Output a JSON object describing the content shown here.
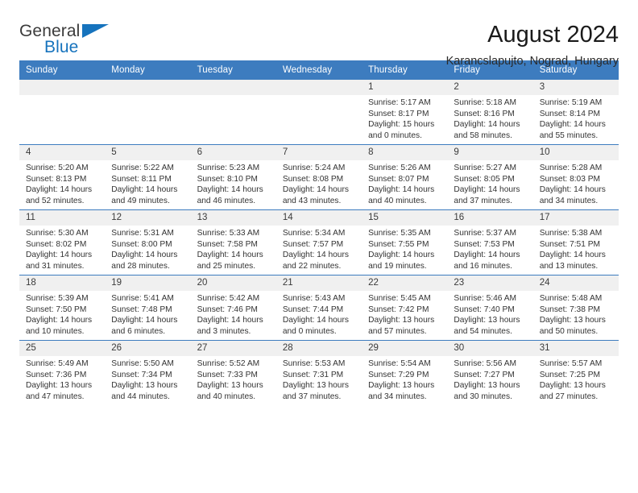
{
  "brand": {
    "word_one": "General",
    "word_two": "Blue",
    "accent_color": "#1673bd",
    "triangle_icon": "triangle-icon"
  },
  "header": {
    "title": "August 2024",
    "subtitle": "Karancslapujto, Nograd, Hungary"
  },
  "calendar": {
    "header_color": "#3d7cbf",
    "weekday_headers": [
      "Sunday",
      "Monday",
      "Tuesday",
      "Wednesday",
      "Thursday",
      "Friday",
      "Saturday"
    ],
    "weeks": [
      [
        {
          "day": "",
          "blank": true
        },
        {
          "day": "",
          "blank": true
        },
        {
          "day": "",
          "blank": true
        },
        {
          "day": "",
          "blank": true
        },
        {
          "day": "1",
          "sunrise": "Sunrise: 5:17 AM",
          "sunset": "Sunset: 8:17 PM",
          "daylight": "Daylight: 15 hours and 0 minutes."
        },
        {
          "day": "2",
          "sunrise": "Sunrise: 5:18 AM",
          "sunset": "Sunset: 8:16 PM",
          "daylight": "Daylight: 14 hours and 58 minutes."
        },
        {
          "day": "3",
          "sunrise": "Sunrise: 5:19 AM",
          "sunset": "Sunset: 8:14 PM",
          "daylight": "Daylight: 14 hours and 55 minutes."
        }
      ],
      [
        {
          "day": "4",
          "sunrise": "Sunrise: 5:20 AM",
          "sunset": "Sunset: 8:13 PM",
          "daylight": "Daylight: 14 hours and 52 minutes."
        },
        {
          "day": "5",
          "sunrise": "Sunrise: 5:22 AM",
          "sunset": "Sunset: 8:11 PM",
          "daylight": "Daylight: 14 hours and 49 minutes."
        },
        {
          "day": "6",
          "sunrise": "Sunrise: 5:23 AM",
          "sunset": "Sunset: 8:10 PM",
          "daylight": "Daylight: 14 hours and 46 minutes."
        },
        {
          "day": "7",
          "sunrise": "Sunrise: 5:24 AM",
          "sunset": "Sunset: 8:08 PM",
          "daylight": "Daylight: 14 hours and 43 minutes."
        },
        {
          "day": "8",
          "sunrise": "Sunrise: 5:26 AM",
          "sunset": "Sunset: 8:07 PM",
          "daylight": "Daylight: 14 hours and 40 minutes."
        },
        {
          "day": "9",
          "sunrise": "Sunrise: 5:27 AM",
          "sunset": "Sunset: 8:05 PM",
          "daylight": "Daylight: 14 hours and 37 minutes."
        },
        {
          "day": "10",
          "sunrise": "Sunrise: 5:28 AM",
          "sunset": "Sunset: 8:03 PM",
          "daylight": "Daylight: 14 hours and 34 minutes."
        }
      ],
      [
        {
          "day": "11",
          "sunrise": "Sunrise: 5:30 AM",
          "sunset": "Sunset: 8:02 PM",
          "daylight": "Daylight: 14 hours and 31 minutes."
        },
        {
          "day": "12",
          "sunrise": "Sunrise: 5:31 AM",
          "sunset": "Sunset: 8:00 PM",
          "daylight": "Daylight: 14 hours and 28 minutes."
        },
        {
          "day": "13",
          "sunrise": "Sunrise: 5:33 AM",
          "sunset": "Sunset: 7:58 PM",
          "daylight": "Daylight: 14 hours and 25 minutes."
        },
        {
          "day": "14",
          "sunrise": "Sunrise: 5:34 AM",
          "sunset": "Sunset: 7:57 PM",
          "daylight": "Daylight: 14 hours and 22 minutes."
        },
        {
          "day": "15",
          "sunrise": "Sunrise: 5:35 AM",
          "sunset": "Sunset: 7:55 PM",
          "daylight": "Daylight: 14 hours and 19 minutes."
        },
        {
          "day": "16",
          "sunrise": "Sunrise: 5:37 AM",
          "sunset": "Sunset: 7:53 PM",
          "daylight": "Daylight: 14 hours and 16 minutes."
        },
        {
          "day": "17",
          "sunrise": "Sunrise: 5:38 AM",
          "sunset": "Sunset: 7:51 PM",
          "daylight": "Daylight: 14 hours and 13 minutes."
        }
      ],
      [
        {
          "day": "18",
          "sunrise": "Sunrise: 5:39 AM",
          "sunset": "Sunset: 7:50 PM",
          "daylight": "Daylight: 14 hours and 10 minutes."
        },
        {
          "day": "19",
          "sunrise": "Sunrise: 5:41 AM",
          "sunset": "Sunset: 7:48 PM",
          "daylight": "Daylight: 14 hours and 6 minutes."
        },
        {
          "day": "20",
          "sunrise": "Sunrise: 5:42 AM",
          "sunset": "Sunset: 7:46 PM",
          "daylight": "Daylight: 14 hours and 3 minutes."
        },
        {
          "day": "21",
          "sunrise": "Sunrise: 5:43 AM",
          "sunset": "Sunset: 7:44 PM",
          "daylight": "Daylight: 14 hours and 0 minutes."
        },
        {
          "day": "22",
          "sunrise": "Sunrise: 5:45 AM",
          "sunset": "Sunset: 7:42 PM",
          "daylight": "Daylight: 13 hours and 57 minutes."
        },
        {
          "day": "23",
          "sunrise": "Sunrise: 5:46 AM",
          "sunset": "Sunset: 7:40 PM",
          "daylight": "Daylight: 13 hours and 54 minutes."
        },
        {
          "day": "24",
          "sunrise": "Sunrise: 5:48 AM",
          "sunset": "Sunset: 7:38 PM",
          "daylight": "Daylight: 13 hours and 50 minutes."
        }
      ],
      [
        {
          "day": "25",
          "sunrise": "Sunrise: 5:49 AM",
          "sunset": "Sunset: 7:36 PM",
          "daylight": "Daylight: 13 hours and 47 minutes."
        },
        {
          "day": "26",
          "sunrise": "Sunrise: 5:50 AM",
          "sunset": "Sunset: 7:34 PM",
          "daylight": "Daylight: 13 hours and 44 minutes."
        },
        {
          "day": "27",
          "sunrise": "Sunrise: 5:52 AM",
          "sunset": "Sunset: 7:33 PM",
          "daylight": "Daylight: 13 hours and 40 minutes."
        },
        {
          "day": "28",
          "sunrise": "Sunrise: 5:53 AM",
          "sunset": "Sunset: 7:31 PM",
          "daylight": "Daylight: 13 hours and 37 minutes."
        },
        {
          "day": "29",
          "sunrise": "Sunrise: 5:54 AM",
          "sunset": "Sunset: 7:29 PM",
          "daylight": "Daylight: 13 hours and 34 minutes."
        },
        {
          "day": "30",
          "sunrise": "Sunrise: 5:56 AM",
          "sunset": "Sunset: 7:27 PM",
          "daylight": "Daylight: 13 hours and 30 minutes."
        },
        {
          "day": "31",
          "sunrise": "Sunrise: 5:57 AM",
          "sunset": "Sunset: 7:25 PM",
          "daylight": "Daylight: 13 hours and 27 minutes."
        }
      ]
    ]
  }
}
